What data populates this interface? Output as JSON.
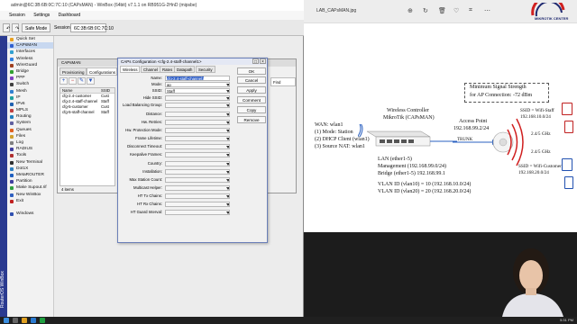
{
  "winbox": {
    "title": "admin@6C:3B:6B:0C:7C:10 (CAPsMAN) - WinBox (64bit) v7.1.1 on RB951G-2HnD (mipsbe)",
    "menu": [
      "Session",
      "Settings",
      "Dashboard"
    ],
    "safe_mode": "Safe Mode",
    "session_label": "Session:",
    "session_value": "6C:3B:6B:0C:7C:10",
    "side_text": "RouterOS WinBox",
    "nav": [
      "Quick Set",
      "CAPsMAN",
      "Interfaces",
      "Wireless",
      "WireGuard",
      "Bridge",
      "PPP",
      "Switch",
      "Mesh",
      "IP",
      "IPv6",
      "MPLS",
      "Routing",
      "System",
      "Queues",
      "Files",
      "Log",
      "RADIUS",
      "Tools",
      "New Terminal",
      "Dot1X",
      "MetaROUTER",
      "Partition",
      "Make Supout.rif",
      "New WinBox",
      "Exit",
      "",
      "Windows"
    ],
    "nav_colors": [
      "#e8a020",
      "#3060d0",
      "#30a0d0",
      "#3080e0",
      "#a04020",
      "#30a030",
      "#8040c0",
      "#404040",
      "#3080d0",
      "#20a0a0",
      "#2060b0",
      "#c04040",
      "#2080c0",
      "#6060a0",
      "#e06020",
      "#d0a030",
      "#808080",
      "#4040a0",
      "#b03030",
      "#303030",
      "#3080c0",
      "#2060c0",
      "#4040a0",
      "#30a040",
      "#3060c0",
      "#c02020",
      "#ffffff",
      "#3050b0"
    ]
  },
  "capsman": {
    "title": "CAPsMAN",
    "tabs": [
      "Provisioning",
      "Configurations"
    ],
    "list_header": [
      "Name",
      "SSID"
    ],
    "rows": [
      "cfg-2.4-customer",
      "cfg-2.4-staff-channel",
      "cfg-5-customer",
      "cfg-5-staff-channel"
    ],
    "rows_ssid": [
      "Cust",
      "Staff",
      "Cust",
      "Staff"
    ],
    "count": "4 items",
    "find": "Find"
  },
  "dialog": {
    "title": "CAPs Configuration <cfg-2.4-staff-channel1>",
    "tabs": [
      "Wireless",
      "Channel",
      "Rates",
      "Datapath",
      "Security"
    ],
    "fields": [
      {
        "label": "Name:",
        "value": "cfg-2.4-staff-channel1"
      },
      {
        "label": "Mode:",
        "value": "ap"
      },
      {
        "label": "SSID:",
        "value": "Staff"
      },
      {
        "label": "Hide SSID:",
        "value": ""
      },
      {
        "label": "Load Balancing Group:",
        "value": ""
      },
      {
        "label": "Distance:",
        "value": ""
      },
      {
        "label": "Hw. Retries:",
        "value": ""
      },
      {
        "label": "Hw. Protection Mode:",
        "value": ""
      },
      {
        "label": "Frame Lifetime:",
        "value": ""
      },
      {
        "label": "Disconnect Timeout:",
        "value": ""
      },
      {
        "label": "Keepalive Frames:",
        "value": ""
      },
      {
        "label": "Country:",
        "value": ""
      },
      {
        "label": "Installation:",
        "value": ""
      },
      {
        "label": "Max Station Count:",
        "value": ""
      },
      {
        "label": "Multicast Helper:",
        "value": ""
      },
      {
        "label": "HT Tx Chains:",
        "value": ""
      },
      {
        "label": "HT Rx Chains:",
        "value": ""
      },
      {
        "label": "HT Guard Interval:",
        "value": ""
      }
    ],
    "buttons": [
      "OK",
      "Cancel",
      "Apply",
      "Comment",
      "Copy",
      "Remove"
    ]
  },
  "viewer": {
    "filename": "LAB_CAPsMAN.jpg",
    "logo": "MIKROTIK CENTER"
  },
  "diagram": {
    "wan": [
      "WAN: wlan1",
      "(1) Mode: Station",
      "(2) DHCP Client (wlan1)",
      "(3) Source NAT: wlan1"
    ],
    "controller": [
      "Wireless Controller",
      "MikroTik (CAPsMAN)"
    ],
    "ap": [
      "Access Point",
      "192.168.99.2/24"
    ],
    "trunk": "TRUNK",
    "signal": [
      "Minimum Signal Strength",
      "for AP Connection: -72 dBm"
    ],
    "lan": [
      "LAN (ether1-5)",
      "Management (192.168.99.0/24)",
      "Bridge (ether1-5) 192.168.99.1"
    ],
    "vlan": [
      "VLAN ID (vlan10) = 10 (192.168.10.0/24)",
      "VLAN ID (vlan20) = 20 (192.168.20.0/24)"
    ],
    "ssid_staff": [
      "SSID = Wifi-Staff",
      "192.168.10.0/24"
    ],
    "ssid_cust": [
      "SSID = Wifi-Customer",
      "192.168.20.0/24"
    ],
    "band": [
      "2.4/5 GHz",
      "2.4/5 GHz"
    ]
  },
  "taskbar": {
    "time": "5:31 PM"
  }
}
